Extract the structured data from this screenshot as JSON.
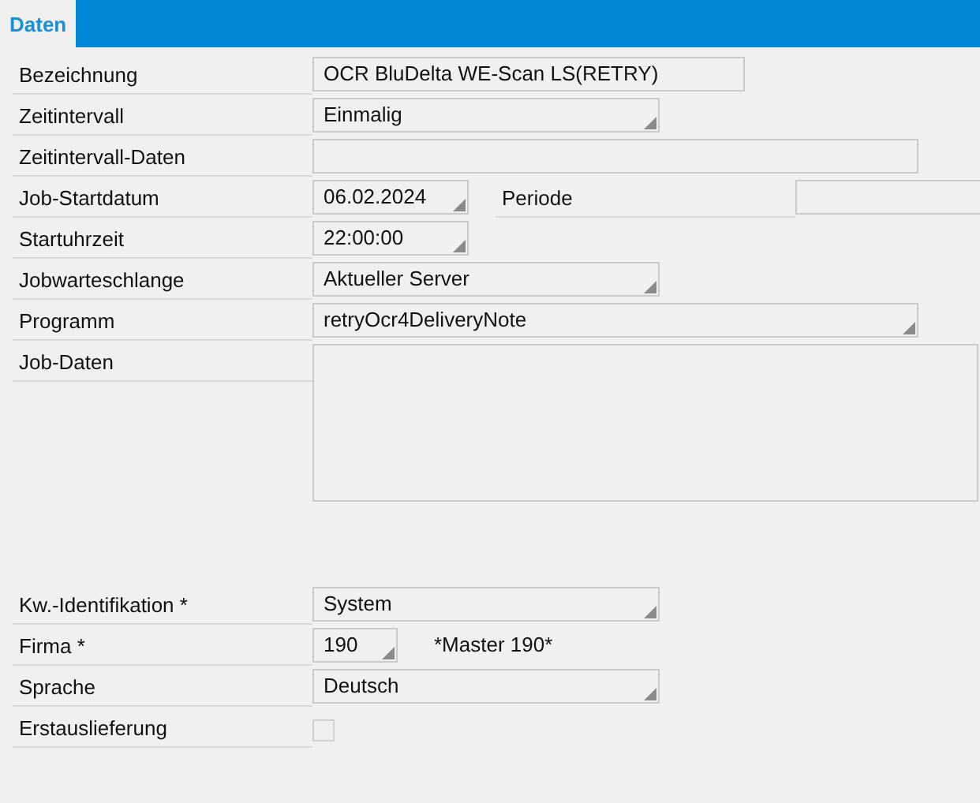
{
  "tabs": [
    {
      "label": "Daten",
      "selected": true
    }
  ],
  "fields": [
    {
      "kind": "text",
      "label": "Bezeichnung",
      "value": "OCR BluDelta WE-Scan LS(RETRY)"
    },
    {
      "kind": "dropdown",
      "label": "Zeitintervall",
      "value": "Einmalig"
    },
    {
      "kind": "text",
      "label": "Zeitintervall-Daten"
    },
    {
      "kind": "dropdown",
      "label": "Job-Startdatum",
      "value": "06.02.2024",
      "extra_label": "Periode"
    },
    {
      "kind": "dropdown",
      "label": "Startuhrzeit",
      "value": "22:00:00"
    },
    {
      "kind": "dropdown",
      "label": "Jobwarteschlange",
      "value": "Aktueller Server"
    },
    {
      "kind": "dropdown",
      "label": "Programm",
      "value": "retryOcr4DeliveryNote"
    },
    {
      "kind": "textarea",
      "label": "Job-Daten"
    },
    {
      "kind": "dropdown",
      "label": "Kw.-Identifikation *",
      "value": "System"
    },
    {
      "kind": "dropdown",
      "label": "Firma *",
      "value": "190",
      "note": "*Master 190*"
    },
    {
      "kind": "dropdown",
      "label": "Sprache",
      "value": "Deutsch"
    },
    {
      "kind": "checkbox",
      "label": "Erstauslieferung",
      "checked": false
    }
  ]
}
